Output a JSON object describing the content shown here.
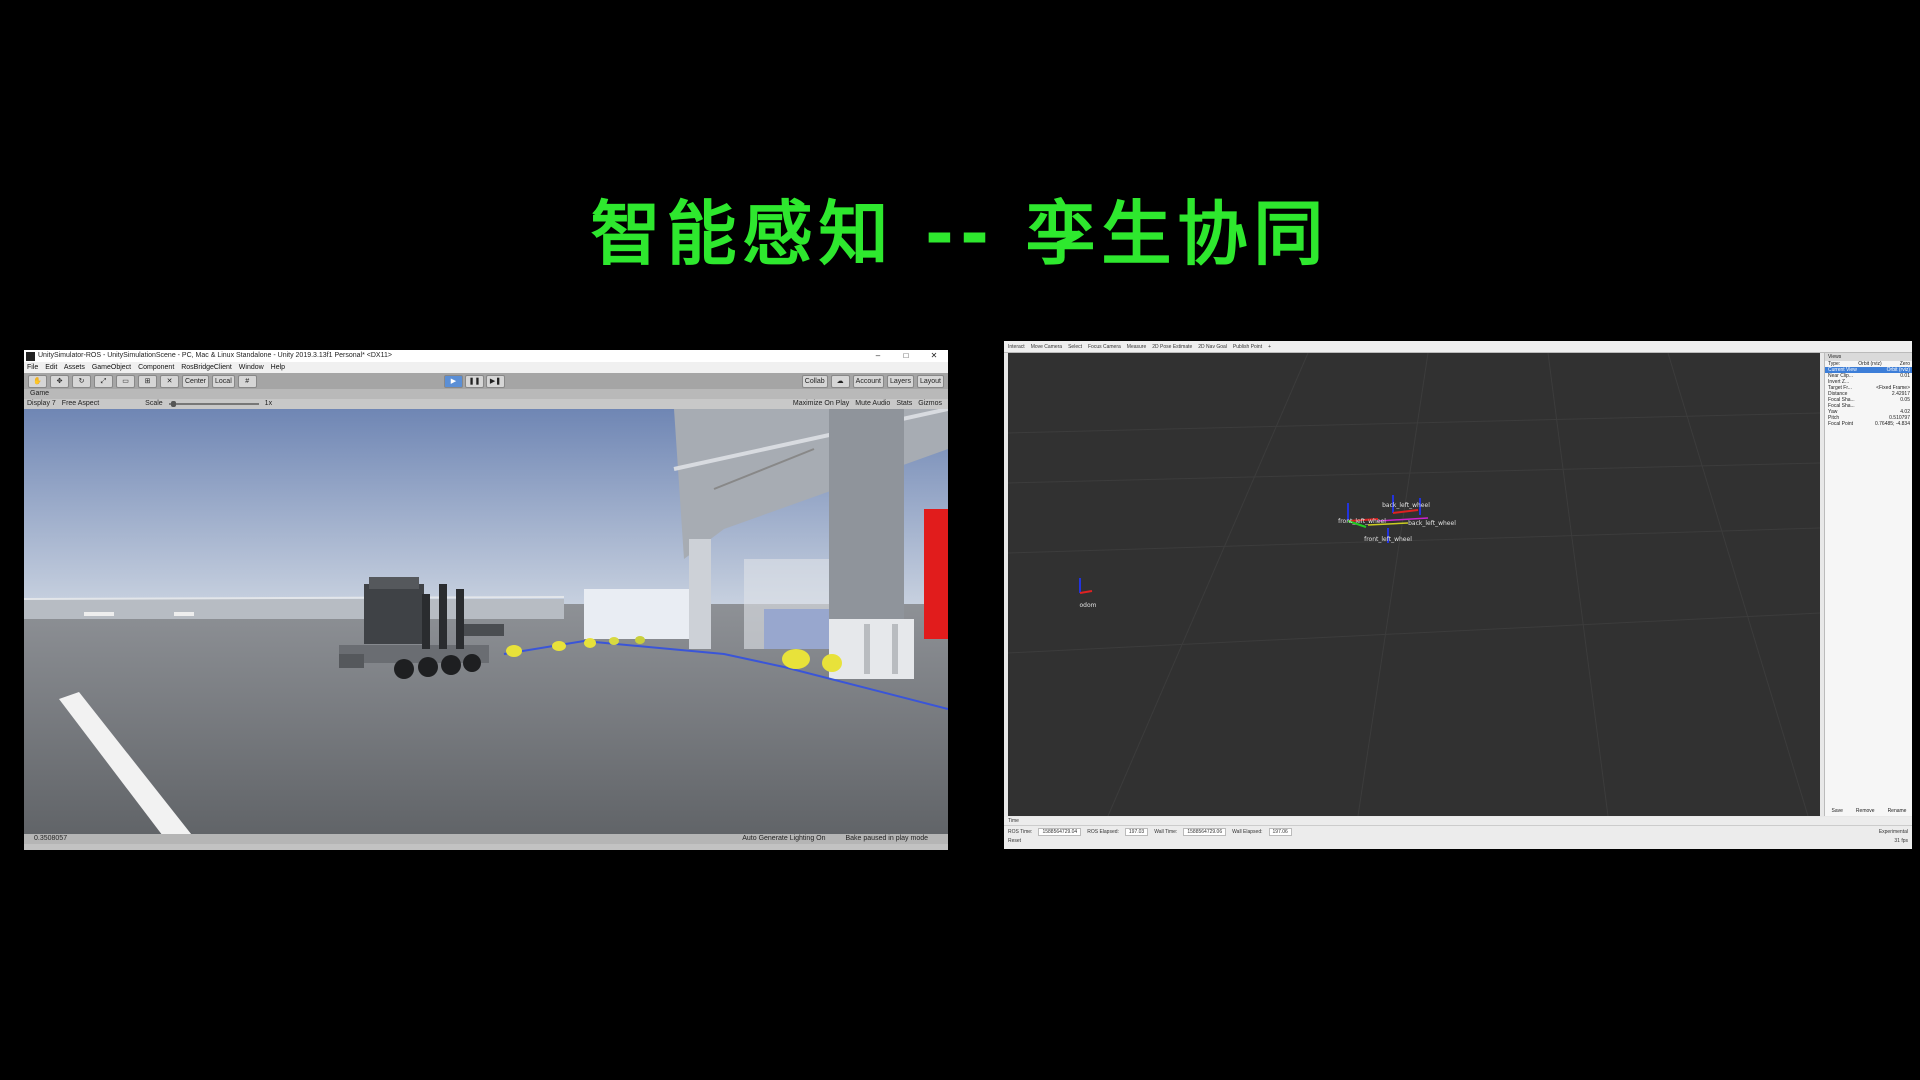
{
  "headline": "智能感知 -- 孪生协同",
  "unity": {
    "window_title": "UnitySimulator-ROS - UnitySimulationScene - PC, Mac & Linux Standalone - Unity 2019.3.13f1 Personal* <DX11>",
    "menu": [
      "File",
      "Edit",
      "Assets",
      "GameObject",
      "Component",
      "RosBridgeClient",
      "Window",
      "Help"
    ],
    "toolbar": {
      "center": "Center",
      "local": "Local",
      "collab": "Collab",
      "account": "Account",
      "layers": "Layers",
      "layout": "Layout"
    },
    "game_tab": "Game",
    "gamebar": {
      "display": "Display 7",
      "aspect": "Free Aspect",
      "scale_label": "Scale",
      "scale_value": "1x",
      "maximize": "Maximize On Play",
      "mute": "Mute Audio",
      "stats": "Stats",
      "gizmos": "Gizmos"
    },
    "status": {
      "value": "0.3508057",
      "lighting": "Auto Generate Lighting On",
      "bake": "Bake paused in play mode"
    }
  },
  "rviz": {
    "toolbar": [
      "Interact",
      "Move Camera",
      "Select",
      "Focus Camera",
      "Measure",
      "2D Pose Estimate",
      "2D Nav Goal",
      "Publish Point"
    ],
    "frames": [
      "back_left_wheel",
      "front_left_wheel",
      "back_left_wheel",
      "front_left_wheel",
      "odom"
    ],
    "views": {
      "header": "Views",
      "type_label": "Type:",
      "type_value": "Orbit (rviz)",
      "zero": "Zero",
      "rows": [
        {
          "k": "Current View",
          "v": "Orbit (rviz)"
        },
        {
          "k": "Near Clip...",
          "v": "0.01"
        },
        {
          "k": "Invert Z...",
          "v": ""
        },
        {
          "k": "Target Fr...",
          "v": "<Fixed Frame>"
        },
        {
          "k": "Distance",
          "v": "2.42917"
        },
        {
          "k": "Focal Sha...",
          "v": "0.05"
        },
        {
          "k": "Focal Sha...",
          "v": ""
        },
        {
          "k": "Yaw",
          "v": "4.02"
        },
        {
          "k": "Pitch",
          "v": "0.510797"
        },
        {
          "k": "Focal Point",
          "v": "0.76485; -4.834"
        }
      ],
      "buttons": [
        "Save",
        "Remove",
        "Rename"
      ]
    },
    "time": {
      "title": "Time",
      "ros_time_label": "ROS Time:",
      "ros_time": "1588564729.04",
      "ros_elapsed_label": "ROS Elapsed:",
      "ros_elapsed": "197.03",
      "wall_time_label": "Wall Time:",
      "wall_time": "1588564729.06",
      "wall_elapsed_label": "Wall Elapsed:",
      "wall_elapsed": "197.06",
      "experimental": "Experimental",
      "reset": "Reset",
      "fps": "31 fps"
    }
  }
}
